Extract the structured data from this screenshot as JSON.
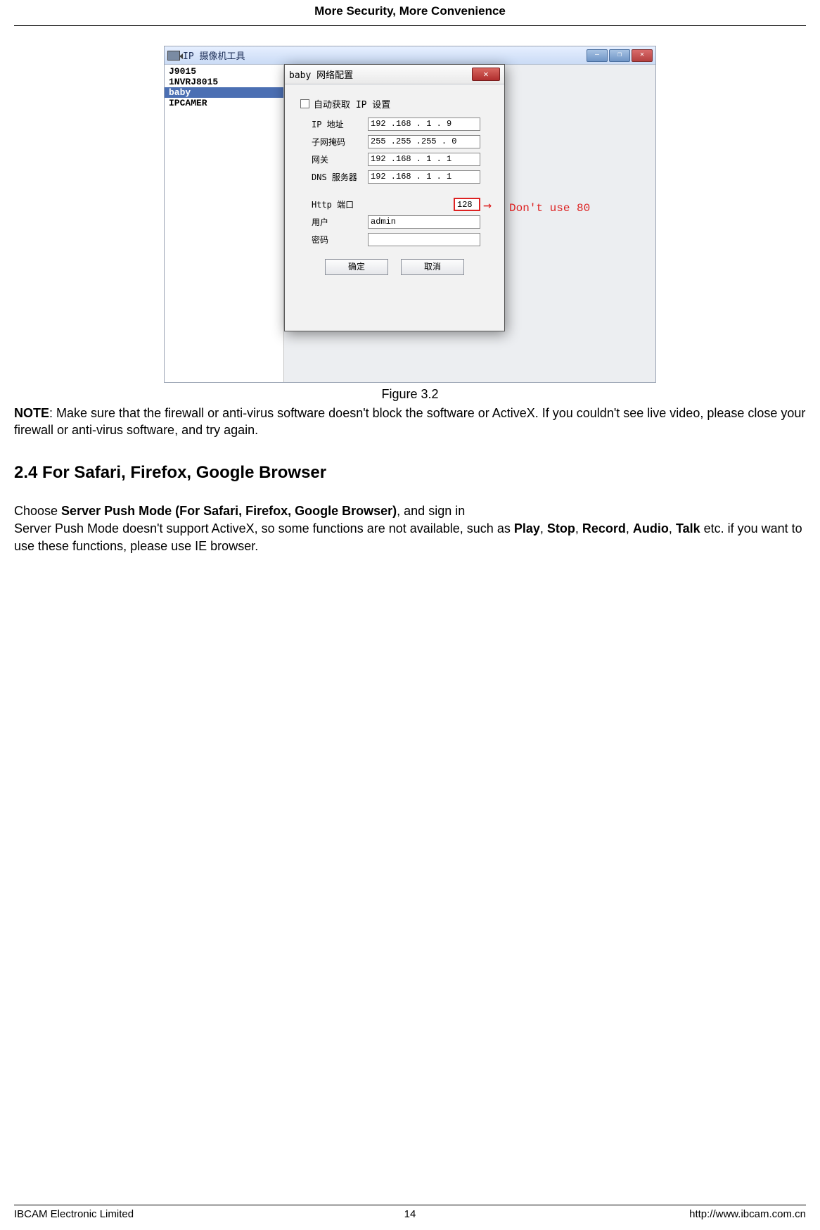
{
  "header": {
    "title": "More Security, More Convenience"
  },
  "screenshot": {
    "toolWindow": {
      "title": "IP 摄像机工具",
      "winButtons": {
        "min": "—",
        "max": "❐",
        "close": "✕"
      }
    },
    "deviceList": [
      {
        "label": "J9015",
        "selected": false
      },
      {
        "label": "1NVRJ8015",
        "selected": false
      },
      {
        "label": "baby",
        "selected": true
      },
      {
        "label": "IPCAMER",
        "selected": false
      }
    ],
    "dialog": {
      "title": "baby 网络配置",
      "close": "✕",
      "autoObtain": "自动获取 IP 设置",
      "fields": {
        "ipLabel": "IP 地址",
        "ip": "192 .168 . 1  . 9",
        "maskLabel": "子网掩码",
        "mask": "255 .255 .255 . 0",
        "gwLabel": "网关",
        "gw": "192 .168 . 1  . 1",
        "dnsLabel": "DNS 服务器",
        "dns": "192 .168 . 1  . 1",
        "portLabel": "Http 端口",
        "port": "128",
        "userLabel": "用户",
        "user": "admin",
        "pwdLabel": "密码",
        "pwd": ""
      },
      "buttons": {
        "ok": "确定",
        "cancel": "取消"
      },
      "annotation": "Don't use 80"
    }
  },
  "figCaption": "Figure 3.2",
  "note": {
    "label": "NOTE",
    "text1": ": Make sure that the firewall or anti-virus software doesn't block the software or ActiveX. If you couldn't see live video, please close your firewall or anti-virus software, and try again."
  },
  "section": {
    "heading": "2.4 For Safari, Firefox, Google Browser"
  },
  "body": {
    "preBold1": "Choose ",
    "bold1": "Server Push Mode (For Safari, Firefox, Google Browser)",
    "after1": ", and sign in",
    "line2a": "Server Push Mode doesn't support ActiveX, so some functions are not available, such as ",
    "b_play": "Play",
    "c1": ", ",
    "b_stop": "Stop",
    "c2": ", ",
    "b_rec": "Record",
    "c3": ", ",
    "b_audio": "Audio",
    "c4": ", ",
    "b_talk": "Talk",
    "line2b": " etc. if you want to use these functions, please use IE browser."
  },
  "footer": {
    "left": "IBCAM Electronic Limited",
    "center": "14",
    "right": "http://www.ibcam.com.cn"
  }
}
